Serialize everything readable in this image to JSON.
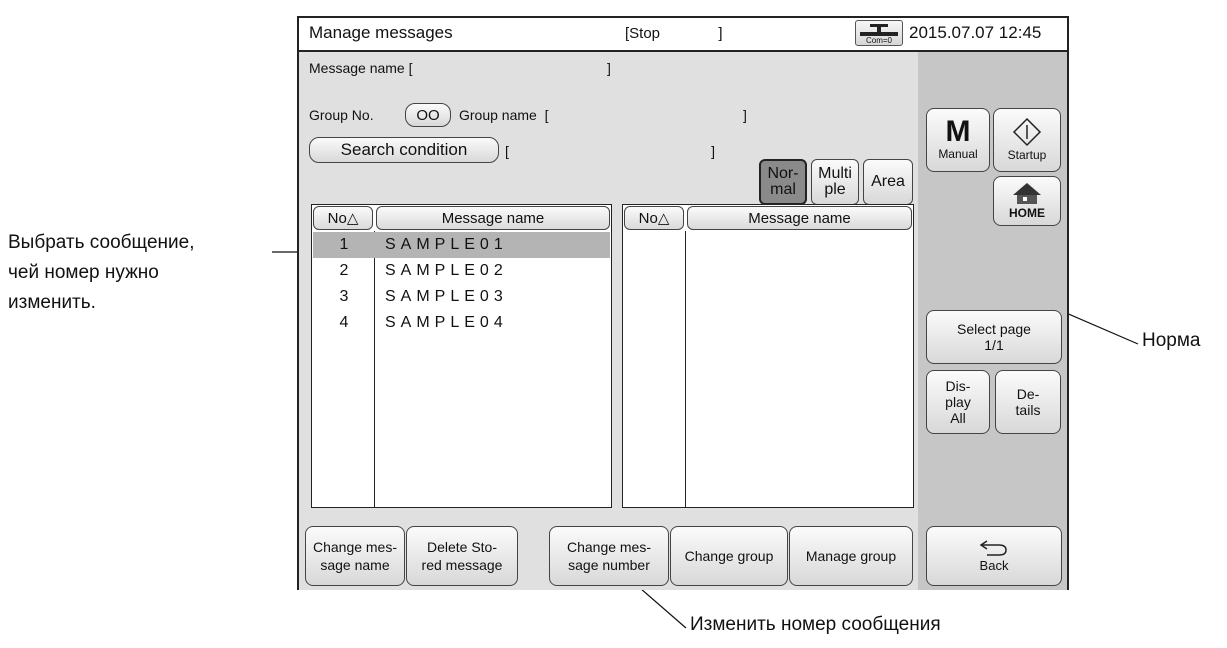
{
  "window": {
    "title": "Manage messages",
    "state": "[Stop              ]",
    "com_label": "Com=0",
    "datetime": "2015.07.07 12:45"
  },
  "fields": {
    "message_name": "Message name [                                                  ]",
    "group_no_label": "Group No.",
    "group_no_value": "OO",
    "group_name": "Group name  [                                                  ]",
    "search_label": "Search condition",
    "search_bracket": "[                                                    ]"
  },
  "modes": {
    "normal_l1": "Nor-",
    "normal_l2": "mal",
    "multiple_l1": "Multi",
    "multiple_l2": "ple",
    "area": "Area",
    "active": "normal"
  },
  "table_left": {
    "col_no": "No△",
    "col_name": "Message name",
    "rows": [
      {
        "no": "1",
        "name": "SAMPLE01",
        "selected": true
      },
      {
        "no": "2",
        "name": "SAMPLE02"
      },
      {
        "no": "3",
        "name": "SAMPLE03"
      },
      {
        "no": "4",
        "name": "SAMPLE04"
      }
    ]
  },
  "table_right": {
    "col_no": "No△",
    "col_name": "Message name"
  },
  "side": {
    "manual_icon": "M",
    "manual": "Manual",
    "startup": "Startup",
    "home": "HOME",
    "select_page_l1": "Select page",
    "select_page_l2": "1/1",
    "display_all_l1": "Dis-",
    "display_all_l2": "play",
    "display_all_l3": "All",
    "details_l1": "De-",
    "details_l2": "tails",
    "back": "Back"
  },
  "bottom": {
    "b1_l1": "Change mes-",
    "b1_l2": "sage name",
    "b2_l1": "Delete Sto-",
    "b2_l2": "red message",
    "b3_l1": "Change mes-",
    "b3_l2": "sage number",
    "b4": "Change group",
    "b5": "Manage group"
  },
  "annotations": {
    "select_l1": "Выбрать сообщение,",
    "select_l2": "чей номер нужно",
    "select_l3": "изменить.",
    "normal": "Норма",
    "change_number": "Изменить номер сообщения"
  }
}
